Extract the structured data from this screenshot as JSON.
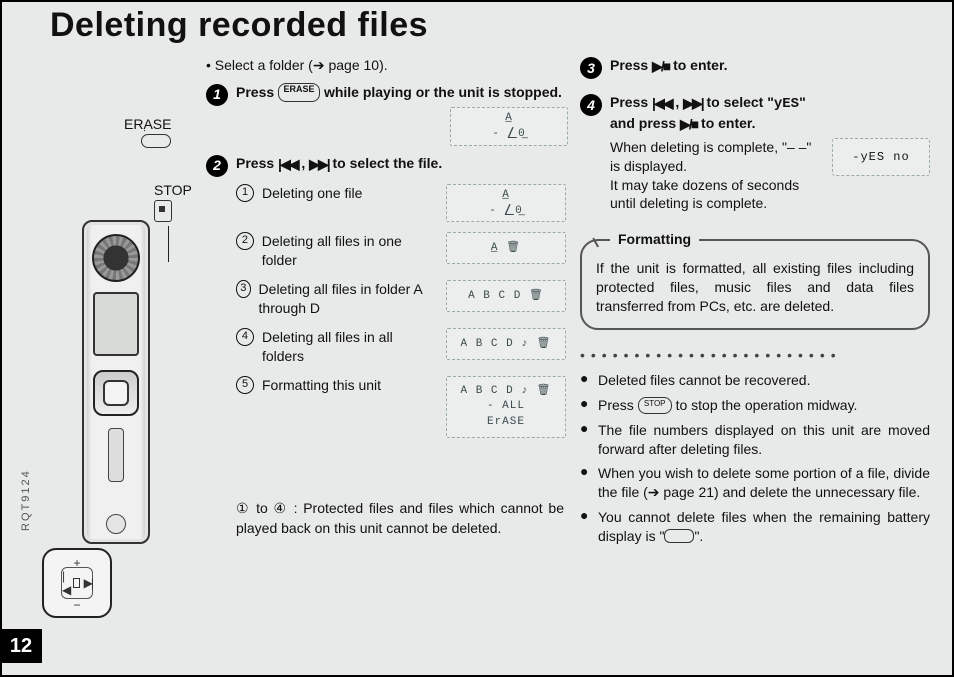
{
  "page_number": "12",
  "doc_code": "RQT9124",
  "title": "Deleting recorded files",
  "labels": {
    "erase": "ERASE",
    "stop": "STOP"
  },
  "intro": {
    "bullet": "• Select a folder (➔ page 10)."
  },
  "icons": {
    "play_stop": "▶/■",
    "prev": "|◀◀",
    "next": "▶▶|",
    "erase_oval": "ERASE",
    "stop_oval": "STOP"
  },
  "steps": {
    "s1": {
      "num": "1",
      "pre": "Press ",
      "post": " while playing or the unit is stopped."
    },
    "s2": {
      "num": "2",
      "title_pre": "Press ",
      "title_mid": ", ",
      "title_post": " to select the file.",
      "items": [
        {
          "n": "1",
          "text": "Deleting one file",
          "lcd": [
            "A̲",
            "- ⎳0̲"
          ]
        },
        {
          "n": "2",
          "text": "Deleting all files in one folder",
          "lcd": [
            "A̲  🗑"
          ]
        },
        {
          "n": "3",
          "text": "Deleting all files in folder A through D",
          "lcd": [
            "A B C D  🗑"
          ]
        },
        {
          "n": "4",
          "text": "Deleting all files in all folders",
          "lcd": [
            "A B C D ♪ 🗑"
          ]
        },
        {
          "n": "5",
          "text": "Formatting this unit",
          "lcd": [
            "A B C D ♪ 🗑",
            "- ALL",
            "ErASE"
          ]
        }
      ],
      "footnote_a": "① to ④ : ",
      "footnote_b": "Protected files and files which cannot be played back on this unit cannot be deleted."
    },
    "s3": {
      "num": "3",
      "pre": "Press ",
      "post": " to enter."
    },
    "s4": {
      "num": "4",
      "line1_pre": "Press ",
      "line1_mid": ", ",
      "line1_post": " to select \"",
      "line1_yes": "yES",
      "line1_end": "\"",
      "line2_pre": "and press ",
      "line2_post": " to enter.",
      "body1": "When deleting is complete, \"– –\" is displayed.",
      "body2": "It may take dozens of seconds until deleting is complete.",
      "lcd": "-yES  no"
    }
  },
  "formatting": {
    "caption": "Formatting",
    "text": "If the unit is formatted, all existing files including protected files, music files and data files transferred from PCs, etc. are deleted."
  },
  "notes": [
    "Deleted files cannot be recovered.",
    "Press  [STOP]  to stop the operation midway.",
    "The file numbers displayed on this unit are moved forward after deleting files.",
    "When you wish to delete some portion of a file, divide the file (➔ page 21) and delete the unnecessary file.",
    "You cannot delete files when the remaining battery display is \"   \"."
  ],
  "lcd_step1": [
    "A̲",
    "- ⎳0̲"
  ]
}
